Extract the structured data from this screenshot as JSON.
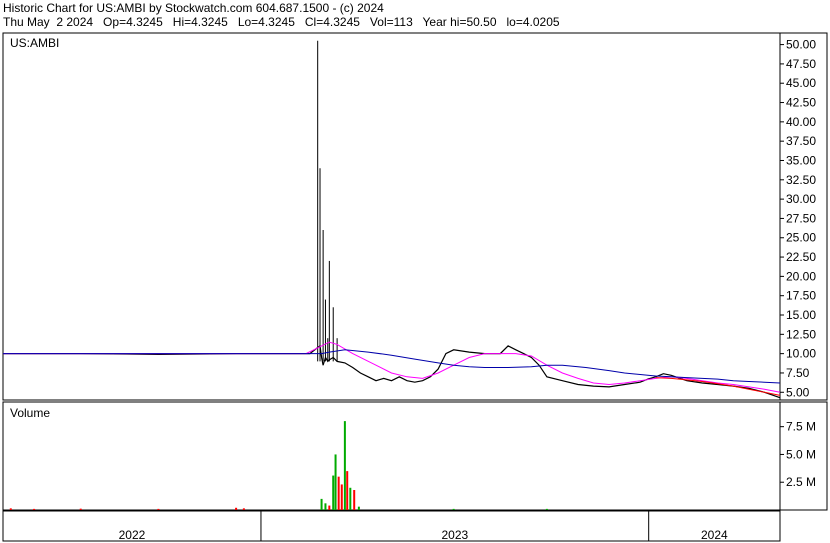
{
  "header": {
    "line1": "Historic Chart for US:AMBI by Stockwatch.com 604.687.1500 - (c) 2024",
    "line2": "Thu May  2 2024   Op=4.3245   Hi=4.3245   Lo=4.3245   Cl=4.3245   Vol=113   Year hi=50.50   lo=4.0205"
  },
  "colors": {
    "price": "#000000",
    "ma_short": "#ff00ff",
    "ma_long": "#0000aa",
    "ma_recent": "#ff0000",
    "volume_up": "#00aa00",
    "volume_down": "#ff0000",
    "frame": "#000000"
  },
  "chart_data": [
    {
      "type": "line",
      "panel": "price",
      "title": "US:AMBI",
      "ylim": [
        4.0,
        51.5
      ],
      "yticks": [
        5.0,
        7.5,
        10.0,
        12.5,
        15.0,
        17.5,
        20.0,
        22.5,
        25.0,
        27.5,
        30.0,
        32.5,
        35.0,
        37.5,
        40.0,
        42.5,
        45.0,
        47.5,
        50.0
      ],
      "ytick_labels": [
        "5.00",
        "7.50",
        "10.00",
        "12.50",
        "15.00",
        "17.50",
        "20.00",
        "22.50",
        "25.00",
        "27.50",
        "30.00",
        "32.50",
        "35.00",
        "37.50",
        "40.00",
        "42.50",
        "45.00",
        "47.50",
        "50.00"
      ],
      "x_label_cells": [
        "2022",
        "2023",
        "2024"
      ],
      "x_domain": [
        0,
        1
      ],
      "year_boundaries": [
        0.332,
        0.831
      ],
      "grid": false,
      "series": [
        {
          "role": "close",
          "x": [
            0.0,
            0.1,
            0.2,
            0.3,
            0.35,
            0.395,
            0.405,
            0.408,
            0.41,
            0.412,
            0.415,
            0.418,
            0.42,
            0.425,
            0.43,
            0.44,
            0.45,
            0.46,
            0.47,
            0.48,
            0.49,
            0.5,
            0.51,
            0.52,
            0.53,
            0.54,
            0.55,
            0.56,
            0.57,
            0.58,
            0.6,
            0.62,
            0.64,
            0.65,
            0.66,
            0.67,
            0.68,
            0.69,
            0.7,
            0.72,
            0.74,
            0.76,
            0.78,
            0.8,
            0.82,
            0.83,
            0.84,
            0.85,
            0.86,
            0.88,
            0.9,
            0.92,
            0.94,
            0.96,
            0.98,
            1.0
          ],
          "y": [
            10.0,
            10.0,
            9.9,
            10.0,
            10.0,
            10.0,
            10.8,
            11.0,
            9.5,
            8.5,
            9.5,
            9.0,
            9.2,
            9.5,
            9.0,
            8.8,
            8.2,
            7.5,
            7.0,
            6.5,
            6.8,
            6.5,
            7.0,
            6.5,
            6.3,
            6.5,
            7.0,
            8.0,
            10.0,
            10.5,
            10.2,
            10.0,
            10.0,
            11.0,
            10.5,
            10.0,
            9.5,
            8.5,
            7.0,
            6.5,
            6.0,
            5.8,
            5.7,
            6.0,
            6.3,
            6.7,
            7.0,
            7.4,
            7.2,
            6.5,
            6.2,
            6.0,
            5.8,
            5.5,
            5.0,
            4.3
          ]
        },
        {
          "role": "high",
          "x": [
            0.405,
            0.408,
            0.412,
            0.415,
            0.418,
            0.42,
            0.425,
            0.43
          ],
          "y": [
            50.5,
            34.0,
            26.0,
            17.0,
            12.0,
            22.0,
            16.0,
            12.0
          ]
        },
        {
          "role": "ma_short",
          "x": [
            0.0,
            0.3,
            0.39,
            0.4,
            0.41,
            0.42,
            0.43,
            0.45,
            0.48,
            0.5,
            0.52,
            0.54,
            0.56,
            0.58,
            0.6,
            0.62,
            0.64,
            0.66,
            0.68,
            0.7,
            0.72,
            0.74,
            0.76,
            0.78,
            0.8,
            0.82,
            0.84,
            0.86,
            0.88,
            0.9,
            0.92,
            0.94,
            0.96,
            0.98,
            1.0
          ],
          "y": [
            10.0,
            10.0,
            10.0,
            10.5,
            11.0,
            11.5,
            11.2,
            10.0,
            8.5,
            7.5,
            7.0,
            6.8,
            7.5,
            8.5,
            9.5,
            10.0,
            10.0,
            10.0,
            9.7,
            8.5,
            7.5,
            6.8,
            6.2,
            6.0,
            6.2,
            6.5,
            6.8,
            7.0,
            6.8,
            6.5,
            6.2,
            6.0,
            5.7,
            5.4,
            5.0
          ]
        },
        {
          "role": "ma_long",
          "x": [
            0.0,
            0.3,
            0.39,
            0.41,
            0.42,
            0.44,
            0.47,
            0.5,
            0.53,
            0.56,
            0.58,
            0.6,
            0.62,
            0.65,
            0.68,
            0.7,
            0.72,
            0.75,
            0.78,
            0.8,
            0.82,
            0.84,
            0.86,
            0.88,
            0.9,
            0.92,
            0.94,
            0.96,
            0.98,
            1.0
          ],
          "y": [
            10.0,
            10.0,
            10.0,
            10.0,
            10.2,
            10.5,
            10.2,
            9.8,
            9.3,
            8.8,
            8.5,
            8.3,
            8.2,
            8.2,
            8.3,
            8.5,
            8.5,
            8.2,
            7.8,
            7.5,
            7.3,
            7.1,
            7.0,
            6.9,
            6.8,
            6.7,
            6.5,
            6.4,
            6.3,
            6.2
          ]
        },
        {
          "role": "ma_recent",
          "x": [
            0.84,
            0.86,
            0.88,
            0.9,
            0.92,
            0.94,
            0.96,
            0.98,
            1.0
          ],
          "y": [
            6.9,
            6.8,
            6.6,
            6.4,
            6.1,
            5.8,
            5.4,
            5.0,
            4.6
          ]
        }
      ]
    },
    {
      "type": "bar",
      "panel": "volume",
      "title": "Volume",
      "ylim": [
        0,
        9000000
      ],
      "yticks": [
        2500000,
        5000000,
        7500000
      ],
      "ytick_labels": [
        "2.5 M",
        "5.0 M",
        "7.5 M"
      ],
      "x_domain": [
        0,
        1
      ],
      "bars": {
        "x": [
          0.01,
          0.04,
          0.1,
          0.2,
          0.3,
          0.31,
          0.41,
          0.415,
          0.42,
          0.425,
          0.428,
          0.432,
          0.436,
          0.44,
          0.443,
          0.447,
          0.452,
          0.458,
          0.58,
          0.7
        ],
        "values": [
          150000,
          100000,
          120000,
          100000,
          200000,
          150000,
          1000000,
          600000,
          400000,
          3100000,
          5000000,
          3000000,
          2300000,
          8000000,
          3500000,
          2000000,
          1800000,
          300000,
          100000,
          100000
        ],
        "direction": [
          "down",
          "down",
          "down",
          "down",
          "down",
          "down",
          "up",
          "up",
          "down",
          "up",
          "up",
          "down",
          "down",
          "up",
          "down",
          "up",
          "down",
          "up",
          "up",
          "up"
        ]
      }
    }
  ]
}
